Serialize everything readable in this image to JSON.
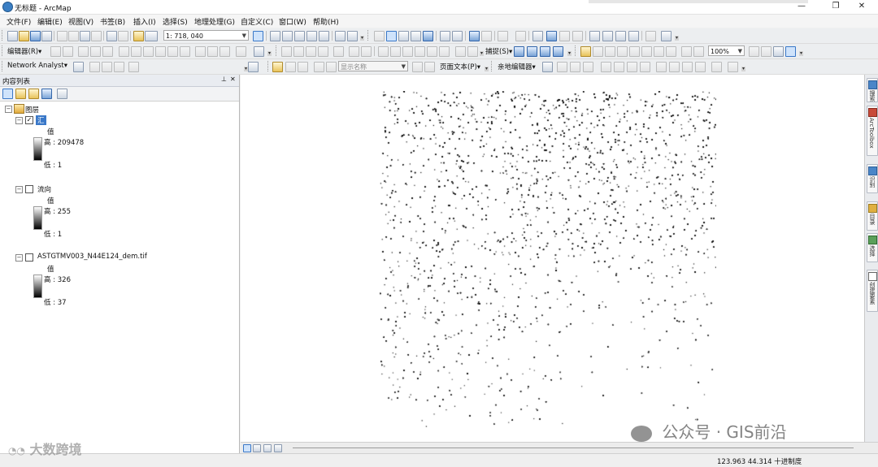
{
  "window": {
    "title": "无标题 - ArcMap",
    "minimize": "—",
    "restore": "❐",
    "close": "✕"
  },
  "menus": [
    "文件(F)",
    "编辑(E)",
    "视图(V)",
    "书签(B)",
    "插入(I)",
    "选择(S)",
    "地理处理(G)",
    "自定义(C)",
    "窗口(W)",
    "帮助(H)"
  ],
  "standard_toolbar": {
    "scale": "1: 718, 040"
  },
  "editor_toolbar": {
    "editor_label": "编辑器(R)▾",
    "snapping_label": "捕捉(S)▾",
    "zoom_value": "100%"
  },
  "network_toolbar": {
    "label": "Network Analyst▾",
    "display_name_placeholder": "显示名称",
    "page_text_label": "页面文本(P)▾",
    "georef_label": "亲地编辑器▾"
  },
  "toc": {
    "title": "内容列表",
    "pin": "📌",
    "close": "✕",
    "root_label": "图层",
    "layers": [
      {
        "name": "汇",
        "checked": true,
        "value_label": "值",
        "high": "高 : 209478",
        "low": "低 : 1"
      },
      {
        "name": "流向",
        "checked": false,
        "value_label": "值",
        "high": "高 : 255",
        "low": "低 : 1"
      },
      {
        "name": "ASTGTMV003_N44E124_dem.tif",
        "checked": false,
        "value_label": "值",
        "high": "高 : 326",
        "low": "低 : 37"
      }
    ]
  },
  "right_dock": {
    "tabs": [
      "搜索",
      "ArcToolbox",
      "识别",
      "目录",
      "选择",
      "创建要素"
    ]
  },
  "status": {
    "coordinates": "123.963  44.314 十进制度"
  },
  "watermarks": {
    "left": "大数跨境",
    "right": "公众号 · GIS前沿"
  },
  "colors": {
    "accent": "#3a78c8",
    "map_background": "#ffffff",
    "raster_dots": "#000000"
  }
}
